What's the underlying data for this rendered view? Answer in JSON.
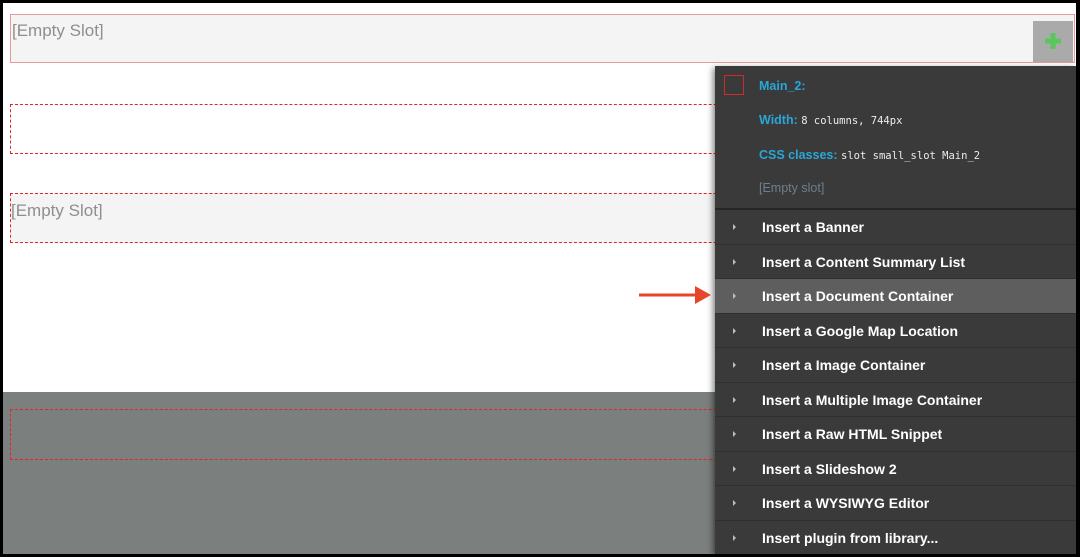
{
  "slots": {
    "slot1_label": "[Empty Slot]",
    "slot3_label": "[Empty Slot]"
  },
  "popup": {
    "name": "Main_2:",
    "width_label": "Width:",
    "width_value": "8 columns, 744px",
    "css_label": "CSS classes:",
    "css_value": "slot small_slot Main_2",
    "empty_text": "[Empty slot]",
    "swatch_color": "#d02a2a"
  },
  "menu": {
    "items": [
      {
        "label": "Insert a Banner"
      },
      {
        "label": "Insert a Content Summary List"
      },
      {
        "label": "Insert a Document Container"
      },
      {
        "label": "Insert a Google Map Location"
      },
      {
        "label": "Insert a Image Container"
      },
      {
        "label": "Insert a Multiple Image Container"
      },
      {
        "label": "Insert a Raw HTML Snippet"
      },
      {
        "label": "Insert a Slideshow 2"
      },
      {
        "label": "Insert a WYSIWYG Editor"
      },
      {
        "label": "Insert plugin from library..."
      }
    ],
    "highlighted_index": 2
  },
  "colors": {
    "accent": "#2aa6d6",
    "add_icon": "#5bc65b",
    "arrow": "#e8462a"
  },
  "icons": {
    "add": "plus-icon",
    "annotation": "arrow-right-icon"
  }
}
